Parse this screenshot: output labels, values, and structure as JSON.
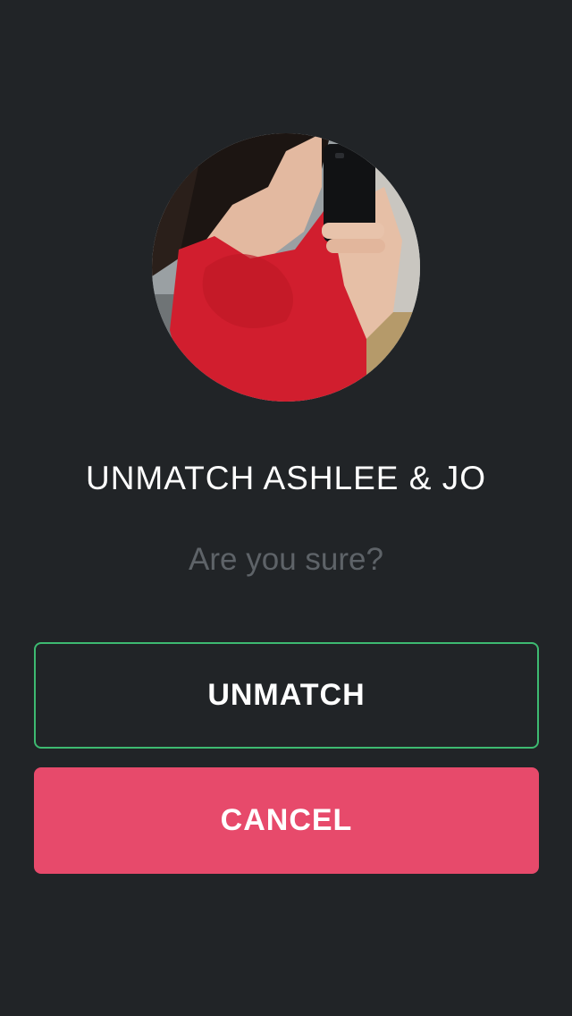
{
  "dialog": {
    "title": "UNMATCH ASHLEE & JO",
    "subtitle": "Are you sure?"
  },
  "buttons": {
    "unmatch_label": "UNMATCH",
    "cancel_label": "CANCEL"
  },
  "colors": {
    "background": "#212427",
    "unmatch_border": "#3dba71",
    "cancel_background": "#e74a6b",
    "subtitle_text": "#5e6368"
  }
}
